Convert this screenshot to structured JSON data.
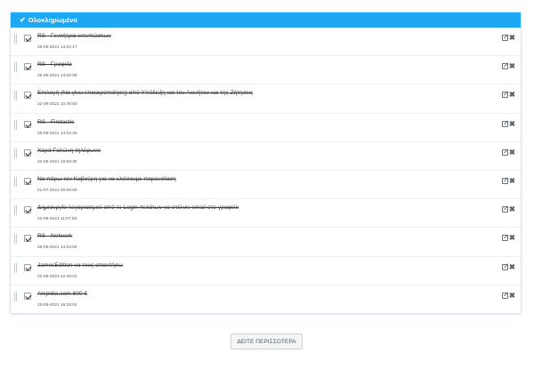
{
  "panel": {
    "title": "Ολοκληρωμένα",
    "check_glyph": "✔",
    "edit_icon": "edit-icon",
    "delete_glyph": "✖"
  },
  "tasks": [
    {
      "title": "RS - Γεννήτρια εκτυπώσεων",
      "date": "26-09-2021 14:01:17",
      "done": true
    },
    {
      "title": "RS - Γραφεία",
      "date": "26-09-2021 14:02:08",
      "done": true
    },
    {
      "title": "Επιλογή (Να γίνει επικαιροποίηση) από Υπόδειξη και του Ακινήτου και της Ζήτησεις",
      "date": "22-09-2021 10:48:50",
      "done": true
    },
    {
      "title": "RS - Findastic",
      "date": "26-09-2021 14:02:29",
      "done": true
    },
    {
      "title": "Χαρά Γαλώνη τηλέφωνο",
      "date": "22-06-2021 19:50:30",
      "done": true
    },
    {
      "title": "Να πάρω τον Καβούρη για να κλείσουμε παρουσίαση",
      "date": "21-07-2021 00:08:00",
      "done": true
    },
    {
      "title": "Δημιουργία λογαριασμού από το Login πελάτων να στέλνει email στο γραφείο",
      "date": "22-09-2021 11:07:00",
      "done": true
    },
    {
      "title": "RS - Network",
      "date": "26-09-2021 14:02:50",
      "done": true
    },
    {
      "title": "JamesEdition να τους απαντήσω",
      "date": "22-06-2021 22:49:01",
      "done": true
    },
    {
      "title": "Alepidia.com 600 €",
      "date": "10-08-2021 16:28:04",
      "done": true
    }
  ],
  "more_button": {
    "label": "ΔΕΙΤΕ ΠΕΡΙΣΣΟΤΕΡΑ"
  }
}
